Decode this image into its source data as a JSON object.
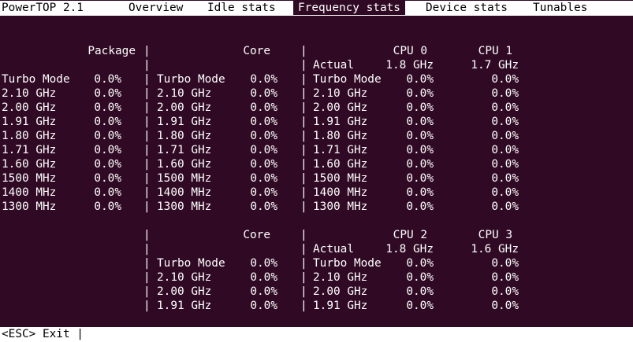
{
  "app_title": "PowerTOP 2.1",
  "tabs": [
    {
      "label": "Overview"
    },
    {
      "label": "Idle stats"
    },
    {
      "label": "Frequency stats"
    },
    {
      "label": "Device stats"
    },
    {
      "label": "Tunables"
    }
  ],
  "active_tab": "Frequency stats",
  "colors": {
    "background": "#300a24",
    "bar": "#ffffff",
    "text": "#ffffff"
  },
  "section1": {
    "package_header": "Package",
    "core_header": "Core",
    "cpu_a_header": "CPU 0",
    "cpu_b_header": "CPU 1",
    "actual_label": "Actual",
    "actual_a": "1.8 GHz",
    "actual_b": "1.7 GHz",
    "rows": [
      {
        "freq": "Turbo Mode",
        "pkg": "0.0%",
        "core": "0.0%",
        "a": "0.0%",
        "b": "0.0%"
      },
      {
        "freq": "2.10 GHz",
        "pkg": "0.0%",
        "core": "0.0%",
        "a": "0.0%",
        "b": "0.0%"
      },
      {
        "freq": "2.00 GHz",
        "pkg": "0.0%",
        "core": "0.0%",
        "a": "0.0%",
        "b": "0.0%"
      },
      {
        "freq": "1.91 GHz",
        "pkg": "0.0%",
        "core": "0.0%",
        "a": "0.0%",
        "b": "0.0%"
      },
      {
        "freq": "1.80 GHz",
        "pkg": "0.0%",
        "core": "0.0%",
        "a": "0.0%",
        "b": "0.0%"
      },
      {
        "freq": "1.71 GHz",
        "pkg": "0.0%",
        "core": "0.0%",
        "a": "0.0%",
        "b": "0.0%"
      },
      {
        "freq": "1.60 GHz",
        "pkg": "0.0%",
        "core": "0.0%",
        "a": "0.0%",
        "b": "0.0%"
      },
      {
        "freq": "1500 MHz",
        "pkg": "0.0%",
        "core": "0.0%",
        "a": "0.0%",
        "b": "0.0%"
      },
      {
        "freq": "1400 MHz",
        "pkg": "0.0%",
        "core": "0.0%",
        "a": "0.0%",
        "b": "0.0%"
      },
      {
        "freq": "1300 MHz",
        "pkg": "0.0%",
        "core": "0.0%",
        "a": "0.0%",
        "b": "0.0%"
      }
    ]
  },
  "section2": {
    "core_header": "Core",
    "cpu_a_header": "CPU 2",
    "cpu_b_header": "CPU 3",
    "actual_label": "Actual",
    "actual_a": "1.8 GHz",
    "actual_b": "1.6 GHz",
    "rows": [
      {
        "freq": "Turbo Mode",
        "core": "0.0%",
        "a": "0.0%",
        "b": "0.0%"
      },
      {
        "freq": "2.10 GHz",
        "core": "0.0%",
        "a": "0.0%",
        "b": "0.0%"
      },
      {
        "freq": "2.00 GHz",
        "core": "0.0%",
        "a": "0.0%",
        "b": "0.0%"
      },
      {
        "freq": "1.91 GHz",
        "core": "0.0%",
        "a": "0.0%",
        "b": "0.0%"
      }
    ]
  },
  "separator": "|",
  "footer": {
    "hint": "<ESC> Exit |"
  }
}
